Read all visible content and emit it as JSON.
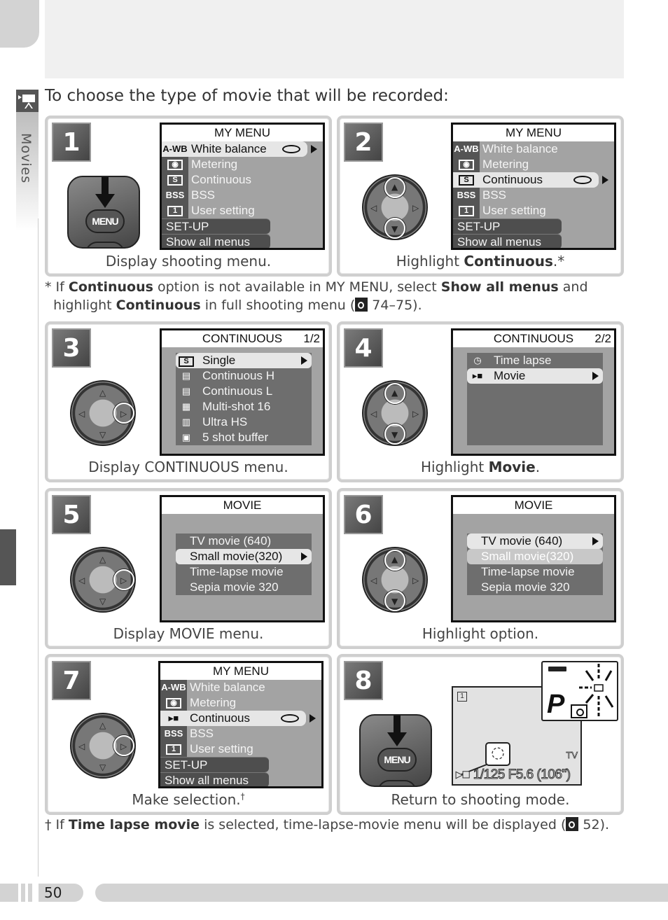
{
  "section": {
    "tab_label": "Movies",
    "intro": "To choose the type of movie that will be recorded:"
  },
  "steps": [
    {
      "number": "1",
      "caption_pre": "Display shooting menu.",
      "caption_bold": "",
      "caption_post": "",
      "control": "MENU button",
      "screen": {
        "title": "MY MENU",
        "items": [
          {
            "icon": "A-WB",
            "label": "White balance",
            "selected": true
          },
          {
            "icon": "metering-icon",
            "label": "Metering"
          },
          {
            "icon": "S",
            "label": "Continuous"
          },
          {
            "icon": "BSS",
            "label": "BSS"
          },
          {
            "icon": "1",
            "label": "User setting"
          }
        ],
        "buttons": [
          "SET-UP",
          "Show all menus"
        ]
      }
    },
    {
      "number": "2",
      "caption_pre": "Highlight ",
      "caption_bold": "Continuous",
      "caption_post": ".*",
      "control": "multi selector up/down",
      "screen": {
        "title": "MY MENU",
        "items": [
          {
            "icon": "A-WB",
            "label": "White balance"
          },
          {
            "icon": "metering-icon",
            "label": "Metering"
          },
          {
            "icon": "S",
            "label": "Continuous",
            "selected": true
          },
          {
            "icon": "BSS",
            "label": "BSS"
          },
          {
            "icon": "1",
            "label": "User setting"
          }
        ],
        "buttons": [
          "SET-UP",
          "Show all menus"
        ]
      }
    },
    {
      "number": "3",
      "caption_pre": "Display CONTINUOUS menu.",
      "caption_bold": "",
      "caption_post": "",
      "control": "multi selector right",
      "screen": {
        "title": "CONTINUOUS",
        "page": "1/2",
        "items": [
          {
            "icon": "S",
            "label": "Single",
            "selected": true
          },
          {
            "icon": "H",
            "label": "Continuous H"
          },
          {
            "icon": "L",
            "label": "Continuous  L"
          },
          {
            "icon": "16",
            "label": "Multi-shot 16"
          },
          {
            "icon": "UHS",
            "label": "Ultra HS"
          },
          {
            "icon": "5",
            "label": "5 shot buffer"
          }
        ]
      }
    },
    {
      "number": "4",
      "caption_pre": "Highlight ",
      "caption_bold": "Movie",
      "caption_post": ".",
      "control": "multi selector up/down",
      "screen": {
        "title": "CONTINUOUS",
        "page": "2/2",
        "items": [
          {
            "icon": "timer",
            "label": "Time lapse"
          },
          {
            "icon": "movie",
            "label": "Movie",
            "selected": true
          }
        ]
      }
    },
    {
      "number": "5",
      "caption_pre": "Display MOVIE menu.",
      "caption_bold": "",
      "caption_post": "",
      "control": "multi selector right",
      "screen": {
        "title": "MOVIE",
        "items": [
          {
            "label": "TV movie (640)"
          },
          {
            "label": "Small movie(320)",
            "selected": true
          },
          {
            "label": "Time-lapse movie"
          },
          {
            "label": "Sepia movie 320"
          }
        ]
      }
    },
    {
      "number": "6",
      "caption_pre": "Highlight option.",
      "caption_bold": "",
      "caption_post": "",
      "control": "multi selector up/down",
      "screen": {
        "title": "MOVIE",
        "items": [
          {
            "label": "TV movie (640)",
            "selected": true
          },
          {
            "label": "Small movie(320)",
            "previous": true
          },
          {
            "label": "Time-lapse movie"
          },
          {
            "label": "Sepia movie 320"
          }
        ]
      }
    },
    {
      "number": "7",
      "caption_pre": "Make selection.",
      "caption_bold": "",
      "caption_post": "†",
      "control": "multi selector right",
      "screen": {
        "title": "MY MENU",
        "items": [
          {
            "icon": "A-WB",
            "label": "White balance"
          },
          {
            "icon": "metering-icon",
            "label": "Metering"
          },
          {
            "icon": "movie",
            "label": "Continuous",
            "selected": true
          },
          {
            "icon": "BSS",
            "label": "BSS"
          },
          {
            "icon": "1",
            "label": "User setting"
          }
        ],
        "buttons": [
          "SET-UP",
          "Show all menus"
        ]
      }
    },
    {
      "number": "8",
      "caption_pre": "Return to shooting mode.",
      "caption_bold": "",
      "caption_post": "",
      "control": "MENU button",
      "display": {
        "readout": "1/125  F5.6  (106\")",
        "tv_label": "TV",
        "mode": "P"
      }
    }
  ],
  "menu_button_label": "MENU",
  "notes": {
    "star": {
      "mark": "*",
      "t1": "If ",
      "b1": "Continuous",
      "t2": " option is not available in MY MENU, select ",
      "b2": "Show all menus",
      "t3": " and",
      "t4": "highlight ",
      "b3": "Continuous",
      "t5": " in full shooting menu (",
      "ref": " 74–75)."
    },
    "dagger": {
      "mark": "†",
      "t1": "If ",
      "b1": "Time lapse movie",
      "t2": " is selected, time-lapse-movie menu will be displayed (",
      "ref": " 52)."
    }
  },
  "footer": {
    "page_number": "50"
  }
}
